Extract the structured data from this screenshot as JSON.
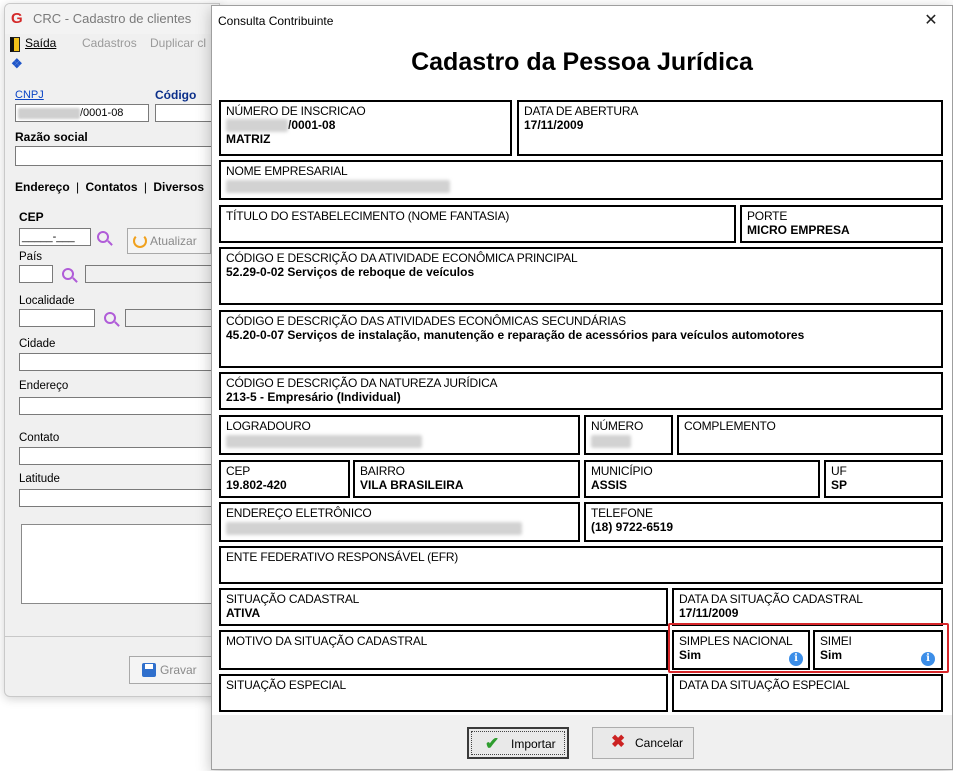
{
  "bg_window": {
    "title": "CRC - Cadastro de clientes",
    "menu": {
      "saida": "Saída",
      "cadastros": "Cadastros",
      "duplicar": "Duplicar cl"
    },
    "cnpj_label": "CNPJ",
    "codigo_label": "Código",
    "cnpj_value_suffix": "/0001-08",
    "razao_social_label": "Razão social",
    "tabs": [
      "Endereço",
      "Contatos",
      "Diversos"
    ],
    "cep_label": "CEP",
    "cep_mask": "_____-___",
    "atualizar_label": "Atualizar",
    "pais_label": "País",
    "localidade_label": "Localidade",
    "cidade_label": "Cidade",
    "endereco_label": "Endereço",
    "contato_label": "Contato",
    "latitude_label": "Latitude",
    "gravar_label": "Gravar"
  },
  "dialog": {
    "title": "Consulta Contribuinte",
    "close": "✕",
    "heading": "Cadastro da Pessoa Jurídica",
    "numero_inscricao": {
      "label": "NÚMERO DE INSCRICAO",
      "value": "/0001-08",
      "sub": "MATRIZ"
    },
    "data_abertura": {
      "label": "DATA DE ABERTURA",
      "value": "17/11/2009"
    },
    "nome_empresarial": {
      "label": "NOME EMPRESARIAL"
    },
    "titulo_estabelecimento": {
      "label": "TÍTULO DO ESTABELECIMENTO (NOME FANTASIA)"
    },
    "porte": {
      "label": "PORTE",
      "value": "MICRO EMPRESA"
    },
    "atividade_principal": {
      "label": "CÓDIGO E DESCRIÇÃO DA ATIVIDADE ECONÔMICA PRINCIPAL",
      "value": "52.29-0-02   Serviços de reboque de veículos"
    },
    "atividades_secundarias": {
      "label": "CÓDIGO E DESCRIÇÃO DAS ATIVIDADES ECONÔMICAS SECUNDÁRIAS",
      "value": "45.20-0-07   Serviços de instalação, manutenção e reparação de acessórios para veículos automotores"
    },
    "natureza_juridica": {
      "label": "CÓDIGO E DESCRIÇÃO DA NATUREZA JURÍDICA",
      "value": "213-5 - Empresário (Individual)"
    },
    "logradouro": {
      "label": "LOGRADOURO"
    },
    "numero": {
      "label": "NÚMERO"
    },
    "complemento": {
      "label": "COMPLEMENTO"
    },
    "cep": {
      "label": "CEP",
      "value": "19.802-420"
    },
    "bairro": {
      "label": "BAIRRO",
      "value": "VILA BRASILEIRA"
    },
    "municipio": {
      "label": "MUNICÍPIO",
      "value": "ASSIS"
    },
    "uf": {
      "label": "UF",
      "value": "SP"
    },
    "endereco_eletronico": {
      "label": "ENDEREÇO ELETRÔNICO"
    },
    "telefone": {
      "label": "TELEFONE",
      "value": "(18) 9722-6519"
    },
    "efr": {
      "label": "ENTE FEDERATIVO RESPONSÁVEL (EFR)"
    },
    "situacao_cadastral": {
      "label": "SITUAÇÃO CADASTRAL",
      "value": "ATIVA"
    },
    "data_situacao_cadastral": {
      "label": "DATA DA SITUAÇÃO CADASTRAL",
      "value": "17/11/2009"
    },
    "motivo_situacao": {
      "label": "MOTIVO DA SITUAÇÃO CADASTRAL"
    },
    "simples_nacional": {
      "label": "SIMPLES NACIONAL",
      "value": "Sim"
    },
    "simei": {
      "label": "SIMEI",
      "value": "Sim"
    },
    "situacao_especial": {
      "label": "SITUAÇÃO ESPECIAL"
    },
    "data_situacao_especial": {
      "label": "DATA DA SITUAÇÃO ESPECIAL"
    },
    "importar_label": "Importar",
    "cancelar_label": "Cancelar",
    "info_glyph": "i"
  },
  "colors": {
    "highlight": "#d7262a",
    "info": "#3c8ee8",
    "accent_link": "#0b45c5"
  }
}
